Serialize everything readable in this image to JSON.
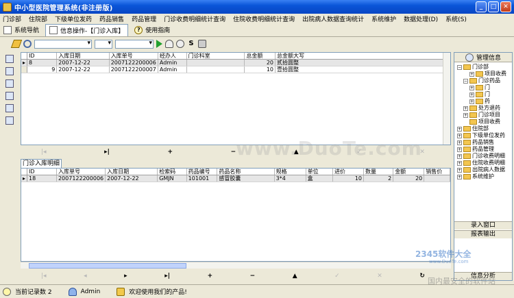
{
  "window": {
    "title": "中小型医院管理系统(非注册版)"
  },
  "menu": [
    "门诊部",
    "住院部",
    "下级单位发药",
    "药品销售",
    "药品管理",
    "门诊收费明细统计查询",
    "住院收费明细统计查询",
    "出院病人数据查询统计",
    "系统维护",
    "数据处理(D)",
    "系统(S)"
  ],
  "tabs": [
    {
      "label": "系统导航"
    },
    {
      "label": "信息操作-【门诊入库】"
    },
    {
      "label": "使用指南"
    }
  ],
  "upper_grid": {
    "columns": [
      "ID",
      "入库日期",
      "入库单号",
      "经办人",
      "门诊科室",
      "总金额",
      "总金额大写"
    ],
    "rows": [
      {
        "ind": "▸",
        "id": "8",
        "date": "2007-12-22",
        "no": "2007122200006",
        "handler": "Admin",
        "dept": "",
        "amount": "20",
        "amount_cn": "贰拾圆整"
      },
      {
        "ind": "",
        "id": "9",
        "date": "2007-12-22",
        "no": "2007122200007",
        "handler": "Admin",
        "dept": "",
        "amount": "10",
        "amount_cn": "壹拾圆整"
      }
    ]
  },
  "detail_tab": "门诊入库明细",
  "lower_grid": {
    "columns": [
      "ID",
      "入库单号",
      "入库日期",
      "检索码",
      "药品编号",
      "药品名称",
      "规格",
      "单位",
      "进价",
      "数量",
      "金额",
      "销售价"
    ],
    "rows": [
      {
        "ind": "▸",
        "id": "18",
        "no": "2007122200006",
        "date": "2007-12-22",
        "code": "GMJN",
        "drug_no": "101001",
        "name": "感冒胶囊",
        "spec": "3*4",
        "unit": "盒",
        "price": "10",
        "qty": "2",
        "amount": "20",
        "sale": ""
      }
    ]
  },
  "nav_upper": [
    "|◂",
    "◂",
    "▸",
    "▸|",
    "+",
    "−",
    "▲",
    "✓",
    "✕",
    "↻"
  ],
  "nav_lower": [
    "|◂",
    "◂",
    "▸",
    "▸|",
    "+",
    "−",
    "▲",
    "✓",
    "✕",
    "↻"
  ],
  "right_panel": {
    "title": "管理信息",
    "tree": [
      {
        "label": "门诊部",
        "level": 0,
        "toggle": "−"
      },
      {
        "label": "项目收费",
        "level": 2,
        "toggle": "+"
      },
      {
        "label": "门诊药品",
        "level": 1,
        "toggle": "−"
      },
      {
        "label": "门",
        "level": 2,
        "toggle": "+"
      },
      {
        "label": "门",
        "level": 2,
        "toggle": "+"
      },
      {
        "label": "药",
        "level": 2,
        "toggle": "+"
      },
      {
        "label": "处方退药",
        "level": 1,
        "toggle": "+"
      },
      {
        "label": "门诊项目",
        "level": 1,
        "toggle": "+"
      },
      {
        "label": "项目收费",
        "level": 1,
        "toggle": ""
      },
      {
        "label": "住院部",
        "level": 0,
        "toggle": "+"
      },
      {
        "label": "下级单位发药",
        "level": 0,
        "toggle": "+"
      },
      {
        "label": "药品销售",
        "level": 0,
        "toggle": "+"
      },
      {
        "label": "药品管理",
        "level": 0,
        "toggle": "+"
      },
      {
        "label": "门诊收费明细",
        "level": 0,
        "toggle": "+"
      },
      {
        "label": "住院收费明细",
        "level": 0,
        "toggle": "+"
      },
      {
        "label": "出院病人数据",
        "level": 0,
        "toggle": "+"
      },
      {
        "label": "系统维护",
        "level": 0,
        "toggle": "+"
      }
    ],
    "buttons": [
      "录入窗口",
      "报表输出",
      "信息分析"
    ]
  },
  "status": {
    "record_label": "当前记录数 2",
    "user": "Admin",
    "welcome": "欢迎使用我们的产品!"
  },
  "watermarks": {
    "main": "www.DuoTe.com",
    "site": "2345软件大全",
    "url": "www.DuoTe.com",
    "bottom": "国内最安全的软件站"
  }
}
